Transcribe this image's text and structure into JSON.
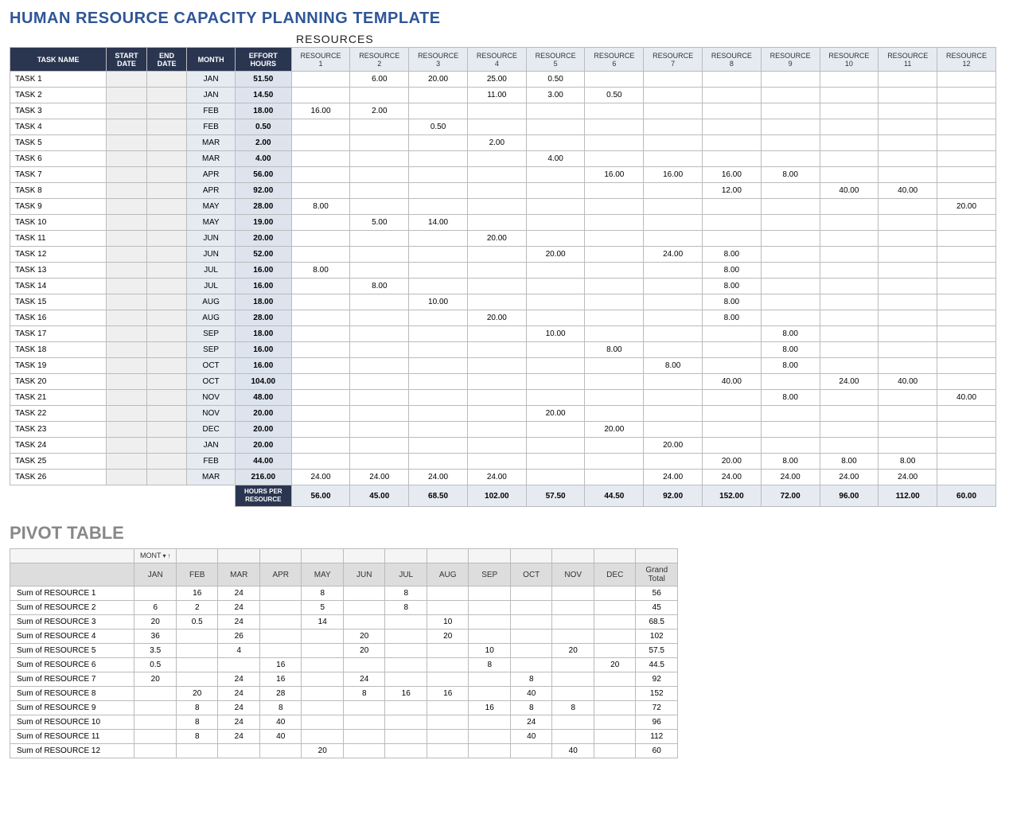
{
  "titles": {
    "main": "HUMAN RESOURCE CAPACITY PLANNING TEMPLATE",
    "resources": "RESOURCES",
    "pivot": "PIVOT TABLE"
  },
  "headers": {
    "task": "TASK NAME",
    "start": "START DATE",
    "end": "END DATE",
    "month": "MONTH",
    "effort": "EFFORT HOURS",
    "res": [
      "RESOURCE 1",
      "RESOURCE 2",
      "RESOURCE 3",
      "RESOURCE 4",
      "RESOURCE 5",
      "RESOURCE 6",
      "RESOURCE 7",
      "RESOURCE 8",
      "RESOURCE 9",
      "RESOURCE 10",
      "RESOURCE 11",
      "RESOURCE 12"
    ],
    "hoursPer": "HOURS PER RESOURCE"
  },
  "rows": [
    {
      "task": "TASK 1",
      "month": "JAN",
      "effort": "51.50",
      "r": [
        "",
        "6.00",
        "20.00",
        "25.00",
        "0.50",
        "",
        "",
        "",
        "",
        "",
        "",
        ""
      ]
    },
    {
      "task": "TASK 2",
      "month": "JAN",
      "effort": "14.50",
      "r": [
        "",
        "",
        "",
        "11.00",
        "3.00",
        "0.50",
        "",
        "",
        "",
        "",
        "",
        ""
      ]
    },
    {
      "task": "TASK 3",
      "month": "FEB",
      "effort": "18.00",
      "r": [
        "16.00",
        "2.00",
        "",
        "",
        "",
        "",
        "",
        "",
        "",
        "",
        "",
        ""
      ]
    },
    {
      "task": "TASK 4",
      "month": "FEB",
      "effort": "0.50",
      "r": [
        "",
        "",
        "0.50",
        "",
        "",
        "",
        "",
        "",
        "",
        "",
        "",
        ""
      ]
    },
    {
      "task": "TASK 5",
      "month": "MAR",
      "effort": "2.00",
      "r": [
        "",
        "",
        "",
        "2.00",
        "",
        "",
        "",
        "",
        "",
        "",
        "",
        ""
      ]
    },
    {
      "task": "TASK 6",
      "month": "MAR",
      "effort": "4.00",
      "r": [
        "",
        "",
        "",
        "",
        "4.00",
        "",
        "",
        "",
        "",
        "",
        "",
        ""
      ]
    },
    {
      "task": "TASK 7",
      "month": "APR",
      "effort": "56.00",
      "r": [
        "",
        "",
        "",
        "",
        "",
        "16.00",
        "16.00",
        "16.00",
        "8.00",
        "",
        "",
        ""
      ]
    },
    {
      "task": "TASK 8",
      "month": "APR",
      "effort": "92.00",
      "r": [
        "",
        "",
        "",
        "",
        "",
        "",
        "",
        "12.00",
        "",
        "40.00",
        "40.00",
        ""
      ]
    },
    {
      "task": "TASK 9",
      "month": "MAY",
      "effort": "28.00",
      "r": [
        "8.00",
        "",
        "",
        "",
        "",
        "",
        "",
        "",
        "",
        "",
        "",
        "20.00"
      ]
    },
    {
      "task": "TASK 10",
      "month": "MAY",
      "effort": "19.00",
      "r": [
        "",
        "5.00",
        "14.00",
        "",
        "",
        "",
        "",
        "",
        "",
        "",
        "",
        ""
      ]
    },
    {
      "task": "TASK 11",
      "month": "JUN",
      "effort": "20.00",
      "r": [
        "",
        "",
        "",
        "20.00",
        "",
        "",
        "",
        "",
        "",
        "",
        "",
        ""
      ]
    },
    {
      "task": "TASK 12",
      "month": "JUN",
      "effort": "52.00",
      "r": [
        "",
        "",
        "",
        "",
        "20.00",
        "",
        "24.00",
        "8.00",
        "",
        "",
        "",
        ""
      ]
    },
    {
      "task": "TASK 13",
      "month": "JUL",
      "effort": "16.00",
      "r": [
        "8.00",
        "",
        "",
        "",
        "",
        "",
        "",
        "8.00",
        "",
        "",
        "",
        ""
      ]
    },
    {
      "task": "TASK 14",
      "month": "JUL",
      "effort": "16.00",
      "r": [
        "",
        "8.00",
        "",
        "",
        "",
        "",
        "",
        "8.00",
        "",
        "",
        "",
        ""
      ]
    },
    {
      "task": "TASK 15",
      "month": "AUG",
      "effort": "18.00",
      "r": [
        "",
        "",
        "10.00",
        "",
        "",
        "",
        "",
        "8.00",
        "",
        "",
        "",
        ""
      ]
    },
    {
      "task": "TASK 16",
      "month": "AUG",
      "effort": "28.00",
      "r": [
        "",
        "",
        "",
        "20.00",
        "",
        "",
        "",
        "8.00",
        "",
        "",
        "",
        ""
      ]
    },
    {
      "task": "TASK 17",
      "month": "SEP",
      "effort": "18.00",
      "r": [
        "",
        "",
        "",
        "",
        "10.00",
        "",
        "",
        "",
        "8.00",
        "",
        "",
        ""
      ]
    },
    {
      "task": "TASK 18",
      "month": "SEP",
      "effort": "16.00",
      "r": [
        "",
        "",
        "",
        "",
        "",
        "8.00",
        "",
        "",
        "8.00",
        "",
        "",
        ""
      ]
    },
    {
      "task": "TASK 19",
      "month": "OCT",
      "effort": "16.00",
      "r": [
        "",
        "",
        "",
        "",
        "",
        "",
        "8.00",
        "",
        "8.00",
        "",
        "",
        ""
      ]
    },
    {
      "task": "TASK 20",
      "month": "OCT",
      "effort": "104.00",
      "r": [
        "",
        "",
        "",
        "",
        "",
        "",
        "",
        "40.00",
        "",
        "24.00",
        "40.00",
        ""
      ]
    },
    {
      "task": "TASK 21",
      "month": "NOV",
      "effort": "48.00",
      "r": [
        "",
        "",
        "",
        "",
        "",
        "",
        "",
        "",
        "8.00",
        "",
        "",
        "40.00"
      ]
    },
    {
      "task": "TASK 22",
      "month": "NOV",
      "effort": "20.00",
      "r": [
        "",
        "",
        "",
        "",
        "20.00",
        "",
        "",
        "",
        "",
        "",
        "",
        ""
      ]
    },
    {
      "task": "TASK 23",
      "month": "DEC",
      "effort": "20.00",
      "r": [
        "",
        "",
        "",
        "",
        "",
        "20.00",
        "",
        "",
        "",
        "",
        "",
        ""
      ]
    },
    {
      "task": "TASK 24",
      "month": "JAN",
      "effort": "20.00",
      "r": [
        "",
        "",
        "",
        "",
        "",
        "",
        "20.00",
        "",
        "",
        "",
        "",
        ""
      ]
    },
    {
      "task": "TASK 25",
      "month": "FEB",
      "effort": "44.00",
      "r": [
        "",
        "",
        "",
        "",
        "",
        "",
        "",
        "20.00",
        "8.00",
        "8.00",
        "8.00",
        ""
      ]
    },
    {
      "task": "TASK 26",
      "month": "MAR",
      "effort": "216.00",
      "r": [
        "24.00",
        "24.00",
        "24.00",
        "24.00",
        "",
        "",
        "24.00",
        "24.00",
        "24.00",
        "24.00",
        "24.00",
        ""
      ]
    }
  ],
  "totals": [
    "56.00",
    "45.00",
    "68.50",
    "102.00",
    "57.50",
    "44.50",
    "92.00",
    "152.00",
    "72.00",
    "96.00",
    "112.00",
    "60.00"
  ],
  "pivot": {
    "filterLabel": "MONT",
    "months": [
      "JAN",
      "FEB",
      "MAR",
      "APR",
      "MAY",
      "JUN",
      "JUL",
      "AUG",
      "SEP",
      "OCT",
      "NOV",
      "DEC"
    ],
    "grandTotal": "Grand Total",
    "rows": [
      {
        "lbl": "Sum of RESOURCE 1",
        "v": [
          "",
          "16",
          "24",
          "",
          "8",
          "",
          "8",
          "",
          "",
          "",
          "",
          ""
        ],
        "gt": "56"
      },
      {
        "lbl": "Sum of RESOURCE 2",
        "v": [
          "6",
          "2",
          "24",
          "",
          "5",
          "",
          "8",
          "",
          "",
          "",
          "",
          ""
        ],
        "gt": "45"
      },
      {
        "lbl": "Sum of RESOURCE 3",
        "v": [
          "20",
          "0.5",
          "24",
          "",
          "14",
          "",
          "",
          "10",
          "",
          "",
          "",
          ""
        ],
        "gt": "68.5"
      },
      {
        "lbl": "Sum of RESOURCE 4",
        "v": [
          "36",
          "",
          "26",
          "",
          "",
          "20",
          "",
          "20",
          "",
          "",
          "",
          ""
        ],
        "gt": "102"
      },
      {
        "lbl": "Sum of RESOURCE 5",
        "v": [
          "3.5",
          "",
          "4",
          "",
          "",
          "20",
          "",
          "",
          "10",
          "",
          "20",
          ""
        ],
        "gt": "57.5"
      },
      {
        "lbl": "Sum of RESOURCE 6",
        "v": [
          "0.5",
          "",
          "",
          "16",
          "",
          "",
          "",
          "",
          "8",
          "",
          "",
          "20"
        ],
        "gt": "44.5"
      },
      {
        "lbl": "Sum of RESOURCE 7",
        "v": [
          "20",
          "",
          "24",
          "16",
          "",
          "24",
          "",
          "",
          "",
          "8",
          "",
          ""
        ],
        "gt": "92"
      },
      {
        "lbl": "Sum of RESOURCE 8",
        "v": [
          "",
          "20",
          "24",
          "28",
          "",
          "8",
          "16",
          "16",
          "",
          "40",
          "",
          ""
        ],
        "gt": "152"
      },
      {
        "lbl": "Sum of RESOURCE 9",
        "v": [
          "",
          "8",
          "24",
          "8",
          "",
          "",
          "",
          "",
          "16",
          "8",
          "8",
          ""
        ],
        "gt": "72"
      },
      {
        "lbl": "Sum of RESOURCE 10",
        "v": [
          "",
          "8",
          "24",
          "40",
          "",
          "",
          "",
          "",
          "",
          "24",
          "",
          ""
        ],
        "gt": "96"
      },
      {
        "lbl": "Sum of RESOURCE 11",
        "v": [
          "",
          "8",
          "24",
          "40",
          "",
          "",
          "",
          "",
          "",
          "40",
          "",
          ""
        ],
        "gt": "112"
      },
      {
        "lbl": "Sum of RESOURCE 12",
        "v": [
          "",
          "",
          "",
          "",
          "20",
          "",
          "",
          "",
          "",
          "",
          "40",
          ""
        ],
        "gt": "60"
      }
    ]
  }
}
